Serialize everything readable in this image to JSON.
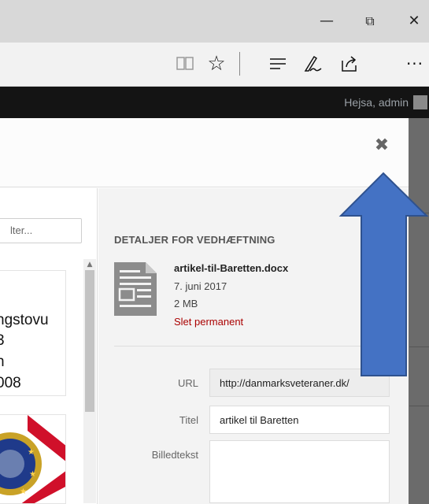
{
  "window_controls": {
    "minimize_glyph": "—",
    "restore_glyph": "⧉",
    "close_glyph": "✕"
  },
  "toolbar": {
    "icons": [
      "reading-view-icon",
      "favorite-star-icon",
      "hub-icon",
      "web-note-icon",
      "share-icon",
      "more-icon"
    ],
    "reading_glyph": "📖",
    "star_glyph": "☆",
    "hub_glyph": "☰",
    "note_glyph": "✎",
    "share_glyph": "⇗",
    "more_glyph": "···"
  },
  "adminbar": {
    "greeting": "Hejsa, admin"
  },
  "modal": {
    "close_glyph": "✖",
    "search_placeholder": "lter...",
    "scroll_up_glyph": "▲",
    "thumb_text_lines": [
      "ngstovu",
      "3",
      "n",
      "008"
    ],
    "details": {
      "heading": "DETALJER FOR VEDHÆFTNING",
      "filename": "artikel-til-Baretten.docx",
      "date": "7. juni 2017",
      "size": "2 MB",
      "delete_link": "Slet permanent",
      "url_label": "URL",
      "url_value": "http://danmarksveteraner.dk/",
      "title_label": "Titel",
      "title_value": "artikel til Baretten",
      "caption_label": "Billedtekst",
      "caption_value": ""
    }
  },
  "colors": {
    "arrow_fill": "#4472c4",
    "arrow_stroke": "#2f528f",
    "delete_red": "#aa0000",
    "admin_bar": "#141414"
  }
}
